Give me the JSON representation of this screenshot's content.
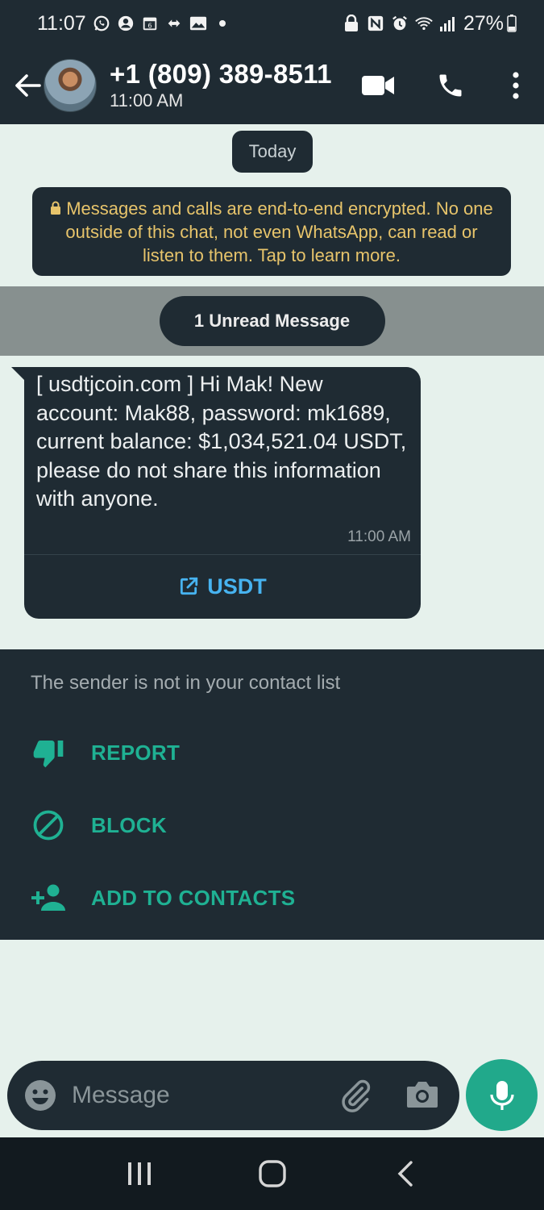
{
  "status_bar": {
    "time": "11:07",
    "battery": "27%"
  },
  "header": {
    "contact_name": "+1 (809) 389-8511",
    "last_seen": "11:00 AM"
  },
  "chat": {
    "date_chip": "Today",
    "encryption_notice": "Messages and calls are end-to-end encrypted. No one outside of this chat, not even WhatsApp, can read or listen to them. Tap to learn more.",
    "unread_label": "1 Unread Message",
    "message": {
      "text": "[ usdtjcoin.com ] Hi Mak! New account: Mak88, password: mk1689, current balance: $1,034,521.04 USDT, please do not share this information with anyone.",
      "time": "11:00 AM",
      "link_label": "USDT"
    }
  },
  "stranger_panel": {
    "note": "The sender is not in your contact list",
    "report_label": "REPORT",
    "block_label": "BLOCK",
    "add_label": "ADD TO CONTACTS"
  },
  "composer": {
    "placeholder": "Message"
  },
  "colors": {
    "header_bg": "#1f2b33",
    "chat_bg": "#e6f1ec",
    "accent_green": "#1fb193",
    "link_blue": "#47b3f0",
    "notice_yellow": "#e7c46b"
  }
}
